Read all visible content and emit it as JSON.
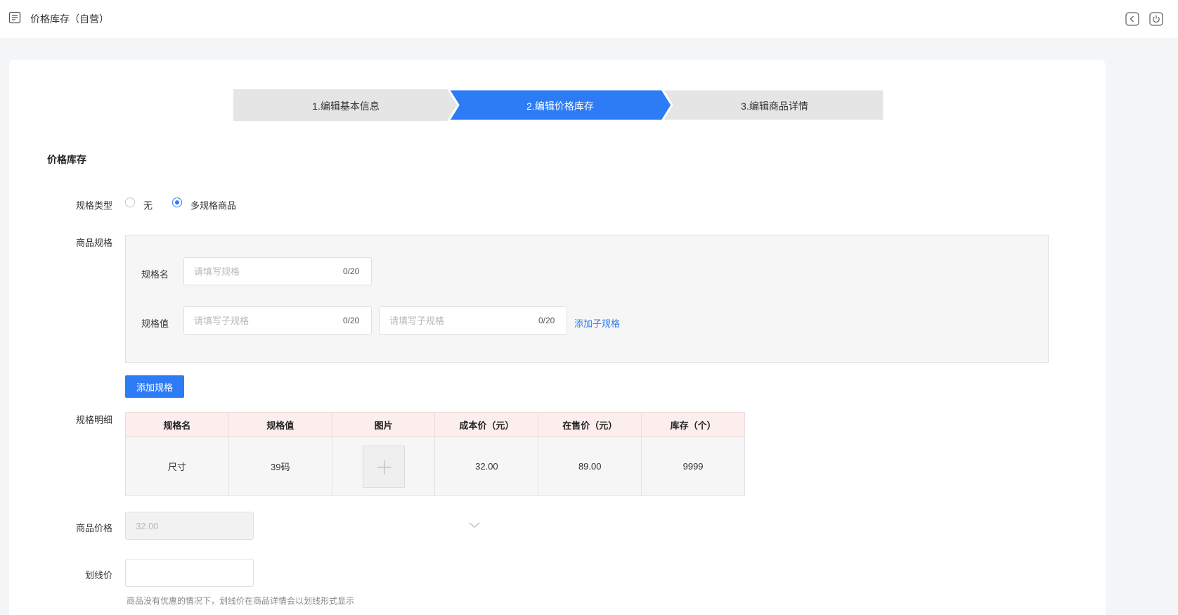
{
  "header": {
    "title": "价格库存（自营）",
    "icons": {
      "menu": "list-menu-icon",
      "back": "back-icon",
      "refresh": "refresh-icon"
    }
  },
  "steps": {
    "items": [
      {
        "label": "1.编辑基本信息",
        "active": false
      },
      {
        "label": "2.编辑价格库存",
        "active": true
      },
      {
        "label": "3.编辑商品详情",
        "active": false
      }
    ],
    "colors": {
      "active": "#2d7cf6",
      "inactive": "#e5e5e5"
    }
  },
  "section": {
    "title": "价格库存"
  },
  "form": {
    "spec_type": {
      "label": "规格类型",
      "options": [
        {
          "label": "无",
          "checked": false
        },
        {
          "label": "多规格商品",
          "checked": true
        }
      ]
    },
    "product_spec": {
      "label": "商品规格",
      "name_label": "规格名",
      "name_placeholder": "请填写规格",
      "name_counter": "0/20",
      "value_label": "规格值",
      "value_placeholder": "请填写子规格",
      "value_counter_1": "0/20",
      "value_counter_2": "0/20",
      "add_sub_spec": "添加子规格"
    },
    "add_spec_button": "添加规格",
    "spec_detail": {
      "label": "规格明细",
      "columns": [
        "规格名",
        "规格值",
        "图片",
        "成本价（元）",
        "在售价（元）",
        "库存（个）"
      ],
      "rows": [
        {
          "name": "尺寸",
          "value": "39码",
          "cost": "32.00",
          "price": "89.00",
          "stock": "9999"
        }
      ]
    },
    "product_price": {
      "label": "商品价格",
      "value": "32.00"
    },
    "strike_price": {
      "label": "划线价",
      "value": "",
      "hint": "商品没有优惠的情况下，划线价在商品详情会以划线形式显示"
    }
  },
  "colors": {
    "accent": "#2d7cf6",
    "table_header_bg": "#fdeeee"
  }
}
